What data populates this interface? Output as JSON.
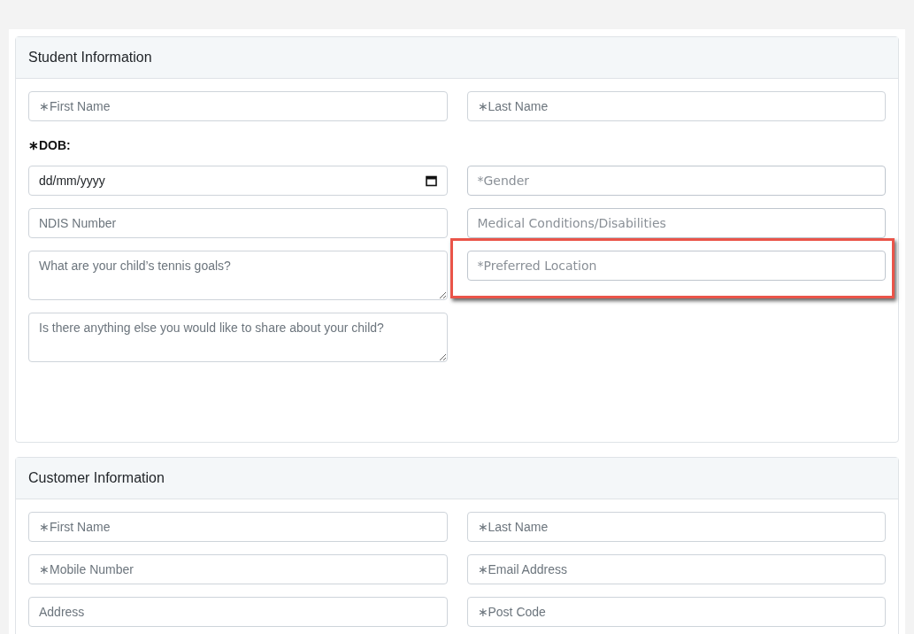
{
  "sections": [
    {
      "title": "Student Information",
      "rows": [
        {
          "kind": "fields",
          "cells": [
            {
              "kind": "input",
              "placeholder": "∗First Name",
              "highlighted": false
            },
            {
              "kind": "input",
              "placeholder": "∗Last Name",
              "highlighted": false
            }
          ]
        },
        {
          "kind": "label",
          "text": "∗DOB:"
        },
        {
          "kind": "fields",
          "cells": [
            {
              "kind": "date",
              "value": "dd/mm/yyyy",
              "highlighted": false
            },
            {
              "kind": "select",
              "placeholder": "*Gender",
              "highlighted": false
            }
          ]
        },
        {
          "kind": "fields",
          "cells": [
            {
              "kind": "input",
              "placeholder": "NDIS Number",
              "highlighted": false
            },
            {
              "kind": "select",
              "placeholder": "Medical Conditions/Disabilities",
              "highlighted": false
            }
          ]
        },
        {
          "kind": "fields",
          "cells": [
            {
              "kind": "textarea",
              "placeholder": "What are your child’s tennis goals?",
              "highlighted": false
            },
            {
              "kind": "select",
              "placeholder": "*Preferred Location",
              "highlighted": true
            }
          ]
        },
        {
          "kind": "fields",
          "cells": [
            {
              "kind": "textarea",
              "placeholder": "Is there anything else you would like to share about your child?",
              "highlighted": false
            }
          ]
        }
      ]
    },
    {
      "title": "Customer Information",
      "rows": [
        {
          "kind": "fields",
          "cells": [
            {
              "kind": "input",
              "placeholder": "∗First Name",
              "highlighted": false
            },
            {
              "kind": "input",
              "placeholder": "∗Last Name",
              "highlighted": false
            }
          ]
        },
        {
          "kind": "fields",
          "cells": [
            {
              "kind": "input",
              "placeholder": "∗Mobile Number",
              "highlighted": false
            },
            {
              "kind": "input",
              "placeholder": "∗Email Address",
              "highlighted": false
            }
          ]
        },
        {
          "kind": "fields",
          "cells": [
            {
              "kind": "input",
              "placeholder": "Address",
              "highlighted": false
            },
            {
              "kind": "input",
              "placeholder": "∗Post Code",
              "highlighted": false
            }
          ]
        }
      ]
    }
  ]
}
